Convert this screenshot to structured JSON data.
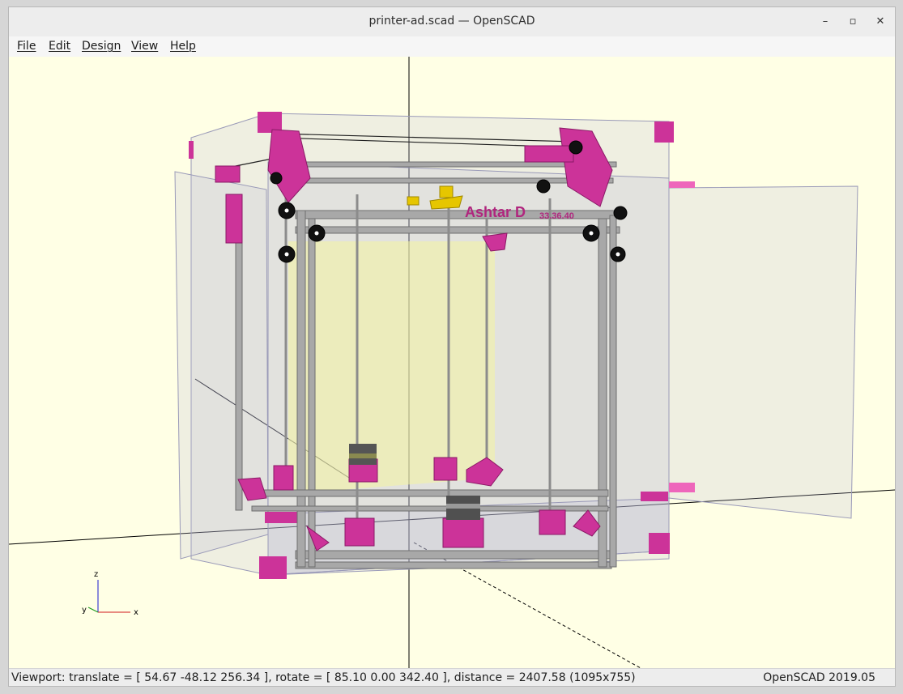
{
  "window": {
    "title": "printer-ad.scad — OpenSCAD",
    "controls": {
      "minimize": "–",
      "maximize": "▫",
      "close": "✕"
    }
  },
  "menubar": {
    "items": [
      {
        "label": "File"
      },
      {
        "label": "Edit"
      },
      {
        "label": "Design"
      },
      {
        "label": "View"
      },
      {
        "label": "Help"
      }
    ]
  },
  "viewport": {
    "background": "#ffffe5",
    "model_text": "Ashtar D",
    "model_subtext": "33.36.40",
    "axes": {
      "z": "z",
      "x": "x",
      "y": "y"
    },
    "colors": {
      "accent": "#cc3399",
      "frame": "#9a9a9a",
      "enclosure": "#b8b8d8"
    }
  },
  "statusbar": {
    "viewport_info": "Viewport: translate = [ 54.67 -48.12 256.34 ], rotate = [ 85.10 0.00 342.40 ], distance = 2407.58 (1095x755)",
    "version": "OpenSCAD 2019.05"
  }
}
